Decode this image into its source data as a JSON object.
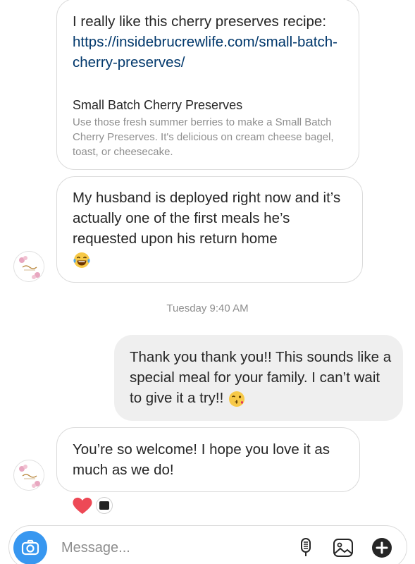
{
  "messages": {
    "link_message": {
      "text_prefix": "I really like this cherry preserves recipe: ",
      "link": "https://insidebrucrewlife.com/small-batch-cherry-preserves/",
      "preview_title": "Small Batch Cherry Preserves",
      "preview_description": "Use those fresh summer berries to make a Small Batch Cherry Preserves. It's delicious on cream cheese bagel, toast, or cheesecake."
    },
    "deployed": {
      "text": "My husband is deployed right now and it’s actually one of the first meals he’s requested upon his return home",
      "emoji": "laughing-tears-emoji"
    },
    "timestamp": "Tuesday 9:40 AM",
    "thanks": {
      "text": "Thank you thank you!! This sounds like a special meal for your family. I can’t wait to give it a try!!",
      "emoji": "kissing-wink-emoji"
    },
    "welcome": {
      "text": "You’re so welcome! I hope you love it as much as we do!"
    }
  },
  "reactions": {
    "icon": "heart-icon",
    "color": "#ed4956"
  },
  "composer": {
    "placeholder": "Message...",
    "camera_icon": "camera-icon",
    "mic_icon": "microphone-icon",
    "gallery_icon": "gallery-icon",
    "add_icon": "plus-circle-icon",
    "accent": "#3897f0"
  }
}
